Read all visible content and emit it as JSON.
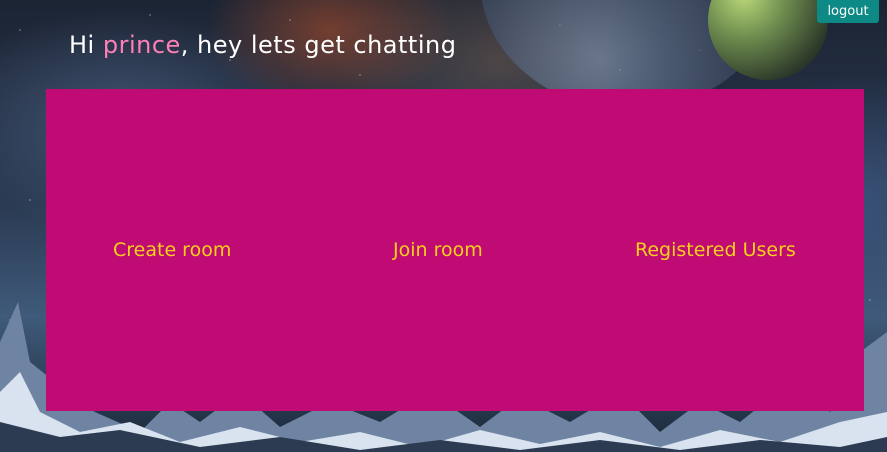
{
  "header": {
    "greeting_prefix": "Hi ",
    "username": "prince",
    "greeting_suffix": ", hey lets get chatting",
    "logout_label": "logout"
  },
  "menu": {
    "items": [
      {
        "label": "Create room"
      },
      {
        "label": "Join room"
      },
      {
        "label": "Registered Users"
      }
    ]
  },
  "colors": {
    "panel": "#c00a74",
    "link": "#f4d21c",
    "username": "#ff7fb8",
    "logout_button": "#0e8a86"
  }
}
